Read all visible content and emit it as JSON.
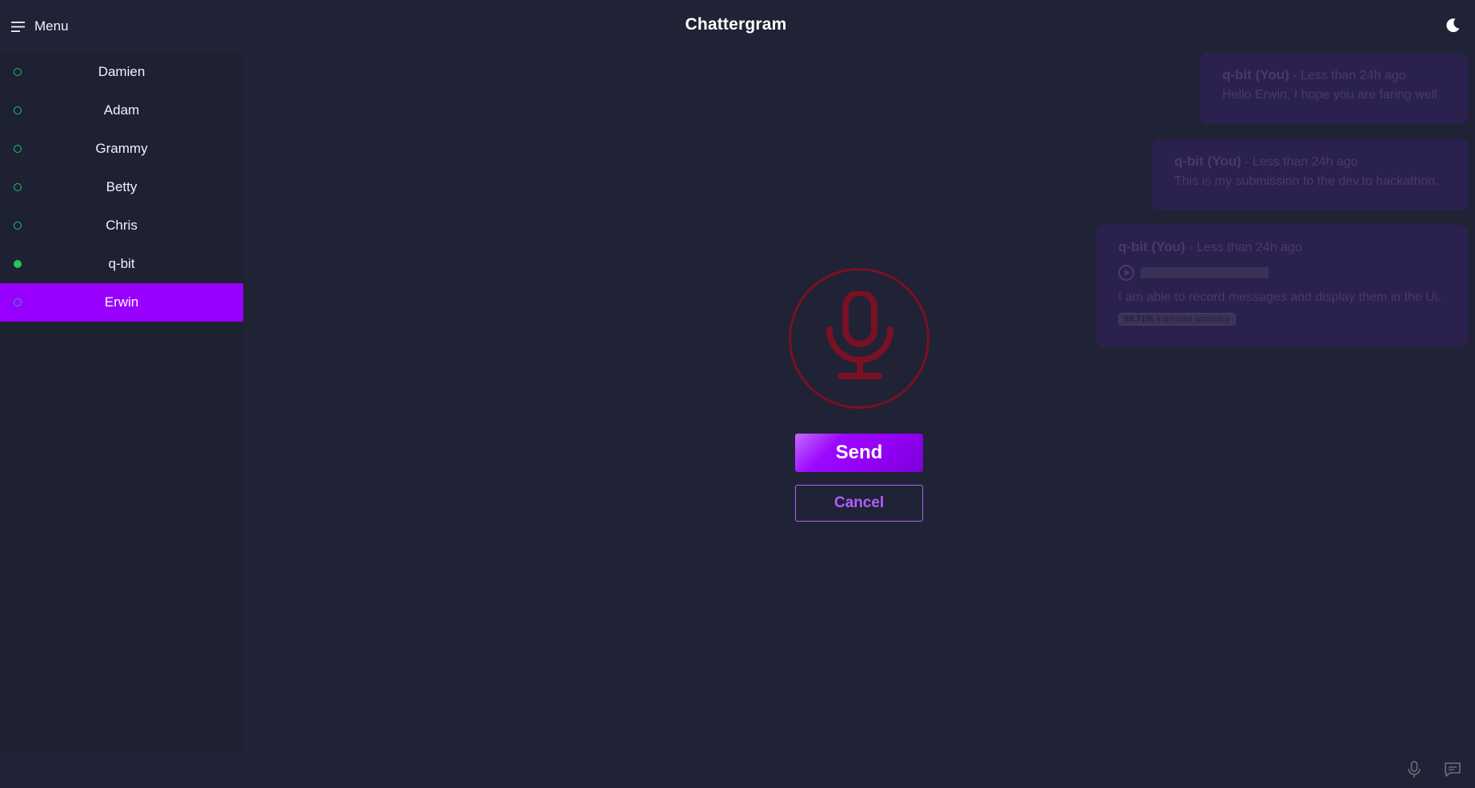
{
  "header": {
    "menu_label": "Menu",
    "app_title": "Chattergram",
    "menu_icon": "hamburger-icon",
    "theme_icon": "moon-icon"
  },
  "sidebar": {
    "contacts": [
      {
        "name": "Damien",
        "online": false,
        "active": false
      },
      {
        "name": "Adam",
        "online": false,
        "active": false
      },
      {
        "name": "Grammy",
        "online": false,
        "active": false
      },
      {
        "name": "Betty",
        "online": false,
        "active": false
      },
      {
        "name": "Chris",
        "online": false,
        "active": false
      },
      {
        "name": "q-bit",
        "online": true,
        "active": false
      },
      {
        "name": "Erwin",
        "online": false,
        "active": true
      }
    ]
  },
  "messages": [
    {
      "author": "q-bit (You)",
      "time": " - Less than 24h ago",
      "text": "Hello Erwin, I hope you are faring well"
    },
    {
      "author": "q-bit (You)",
      "time": " - Less than 24h ago",
      "text": "This is my submission to the dev.to hackathon."
    },
    {
      "author": "q-bit (You)",
      "time": " - Less than 24h ago",
      "text": "I am able to record messages and display them in the Ui.",
      "audio": true,
      "accuracy_value": "99.71%",
      "accuracy_label": " transcript accuracy"
    }
  ],
  "recorder": {
    "mic_icon": "microphone-icon",
    "send_label": "Send",
    "cancel_label": "Cancel"
  },
  "footer": {
    "mic_icon": "microphone-icon",
    "chat_icon": "chat-bubble-icon"
  },
  "colors": {
    "accent": "#9900ff",
    "online": "#22c55e",
    "recording": "#7a1024",
    "background": "#1f2335"
  }
}
